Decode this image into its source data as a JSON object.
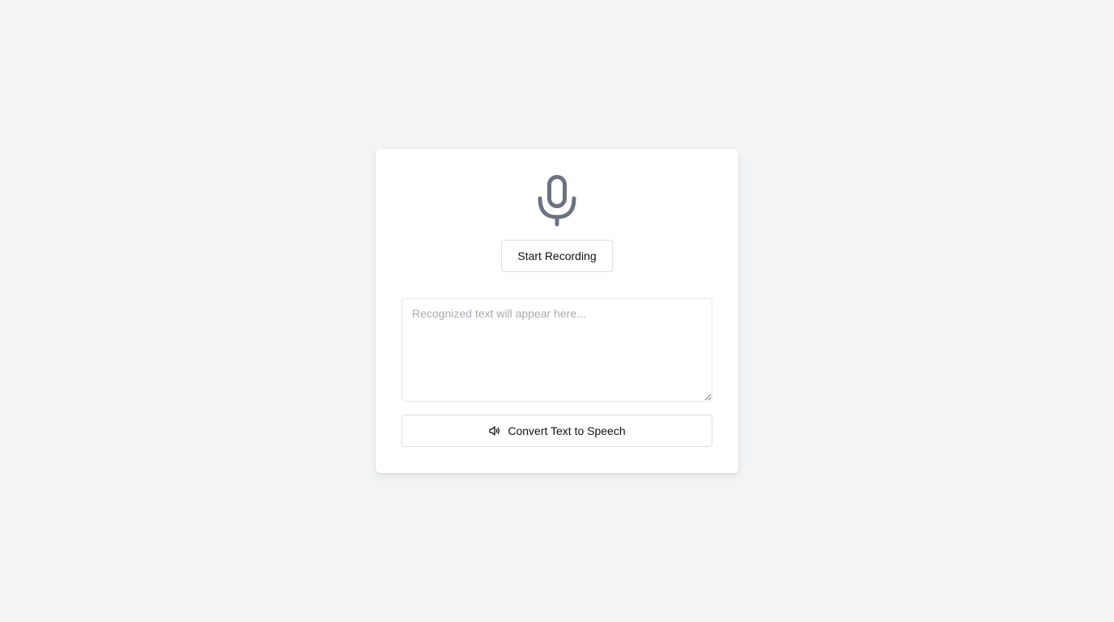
{
  "recorder": {
    "mic_icon": "microphone-icon",
    "record_button_label": "Start Recording"
  },
  "transcript": {
    "placeholder": "Recognized text will appear here...",
    "value": ""
  },
  "tts": {
    "icon": "speaker-icon",
    "button_label": "Convert Text to Speech"
  },
  "colors": {
    "background": "#f3f4f6",
    "card": "#ffffff",
    "icon": "#6b7280",
    "text": "#111111",
    "placeholder": "#a8acb3",
    "border": "#dcdfe4"
  }
}
